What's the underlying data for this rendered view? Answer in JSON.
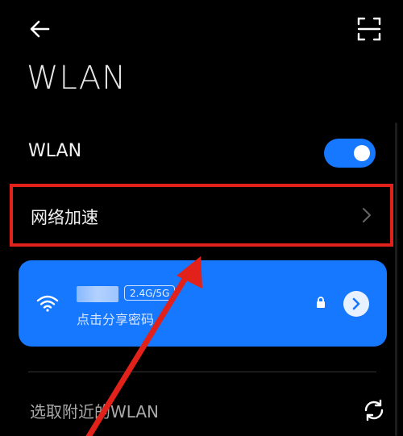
{
  "header": {
    "back_icon": "arrow-left-icon",
    "scan_icon": "scan-frame-icon",
    "title": "WLAN"
  },
  "wlan_toggle": {
    "label": "WLAN",
    "state": "on",
    "color": "#1677ff"
  },
  "network_acceleration": {
    "label": "网络加速",
    "chevron_icon": "chevron-right-icon",
    "highlight_color": "#e3211b"
  },
  "connected_network": {
    "band_badge": "2.4G/5G",
    "subtitle": "点击分享密码",
    "wifi_icon": "wifi-icon",
    "lock_icon": "lock-icon",
    "detail_icon": "chevron-right-circle-icon",
    "card_color": "#1677ff"
  },
  "nearby": {
    "label": "选取附近的WLAN",
    "refresh_icon": "refresh-icon"
  },
  "annotation": {
    "arrow_color": "#e3211b"
  }
}
